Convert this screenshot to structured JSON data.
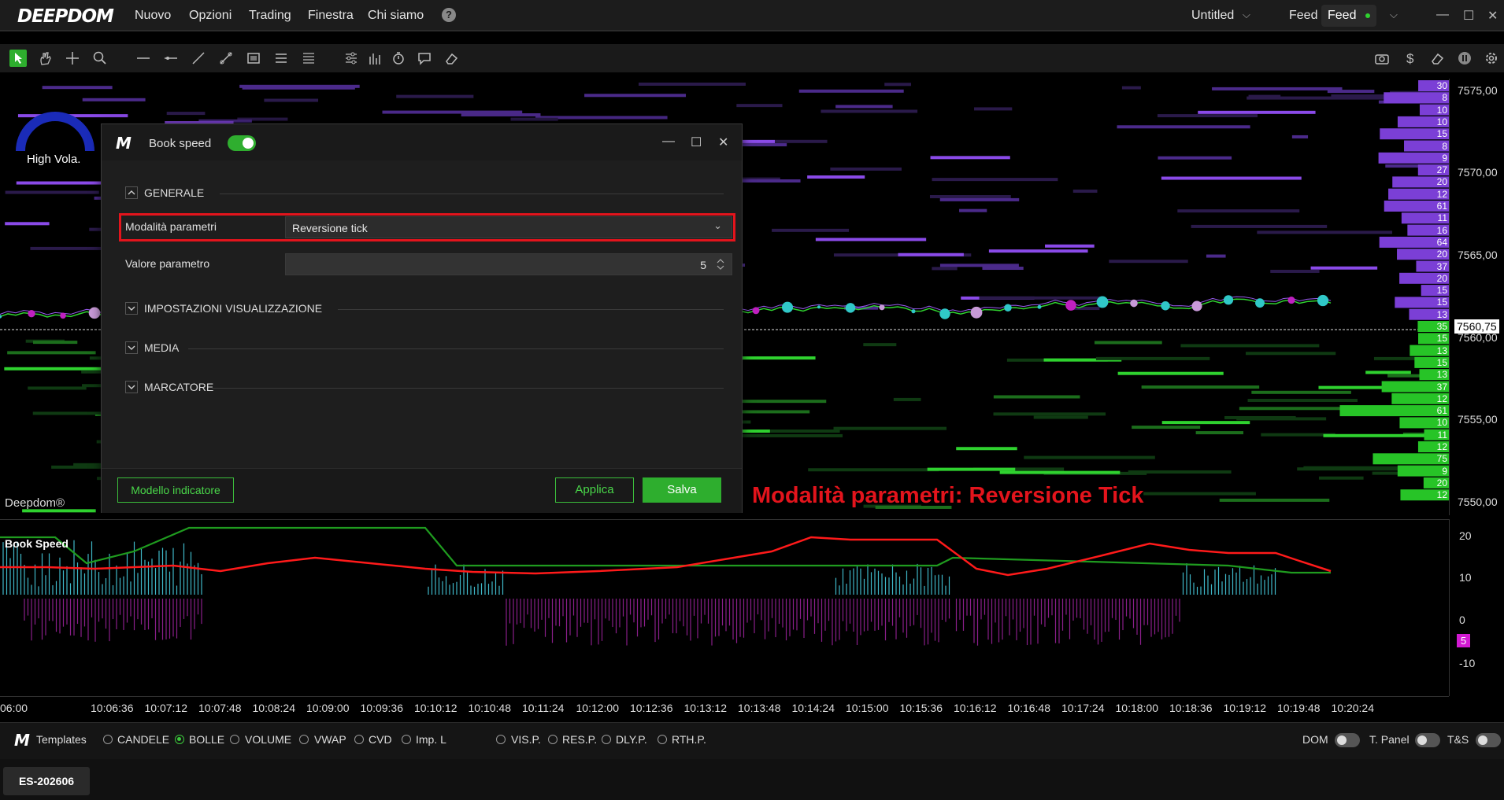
{
  "app": {
    "logo": "DEEPDOM",
    "menu": [
      "Nuovo",
      "Opzioni",
      "Trading",
      "Finestra",
      "Chi siamo"
    ],
    "workspace": "Untitled",
    "feed_label": "Feed",
    "feed_status": "Feed"
  },
  "chart": {
    "vola_label": "High Vola.",
    "watermark": "Deepdom®",
    "price_labels": [
      "7575,00",
      "7570,00",
      "7565,00",
      "7560,00",
      "7555,00",
      "7550,00"
    ],
    "current_price": "7560,75",
    "book_counts": [
      "30",
      "8",
      "10",
      "10",
      "15",
      "8",
      "9",
      "27",
      "20",
      "12",
      "61",
      "11",
      "16",
      "64",
      "20",
      "37",
      "20",
      "15",
      "15",
      "13",
      "35",
      "15",
      "13",
      "15",
      "13",
      "37",
      "12",
      "61",
      "10",
      "11",
      "12",
      "75",
      "9",
      "20",
      "12"
    ]
  },
  "oscillator": {
    "title": "Book Speed",
    "axis_labels": [
      "20",
      "10",
      "0",
      "-10"
    ],
    "current_value": "5"
  },
  "time_axis": [
    "06:00",
    "10:06:36",
    "10:07:12",
    "10:07:48",
    "10:08:24",
    "10:09:00",
    "10:09:36",
    "10:10:12",
    "10:10:48",
    "10:11:24",
    "10:12:00",
    "10:12:36",
    "10:13:12",
    "10:13:48",
    "10:14:24",
    "10:15:00",
    "10:15:36",
    "10:16:12",
    "10:16:48",
    "10:17:24",
    "10:18:00",
    "10:18:36",
    "10:19:12",
    "10:19:48",
    "10:20:24"
  ],
  "dialog": {
    "title": "Book speed",
    "section_general": "GENERALE",
    "param_mode_label": "Modalità parametri",
    "param_mode_value": "Reversione tick",
    "param_value_label": "Valore parametro",
    "param_value": "5",
    "section_display": "IMPOSTAZIONI VISUALIZZAZIONE",
    "section_media": "MEDIA",
    "section_marker": "MARCATORE",
    "model_button": "Modello indicatore",
    "apply_button": "Applica",
    "save_button": "Salva"
  },
  "annotation": "Modalità parametri: Reversione Tick",
  "templates_bar": {
    "label": "Templates",
    "options": [
      "CANDELE",
      "BOLLE",
      "VOLUME",
      "VWAP",
      "CVD",
      "Imp. L"
    ],
    "selected": "BOLLE",
    "profiles": [
      "VIS.P.",
      "RES.P.",
      "DLY.P.",
      "RTH.P."
    ],
    "toggles": [
      "DOM",
      "T. Panel",
      "T&S"
    ]
  },
  "symbol_tab": "ES-202606",
  "colors": {
    "accent_green": "#2eae2e",
    "ask_purple": "#7b3fd6",
    "bid_green": "#27c427",
    "highlight_red": "#e3141c",
    "osc_red": "#ff1a1a",
    "osc_green": "#1f9b1f",
    "osc_cyan": "#3fb8c8",
    "osc_magenta": "#c02cc0"
  }
}
